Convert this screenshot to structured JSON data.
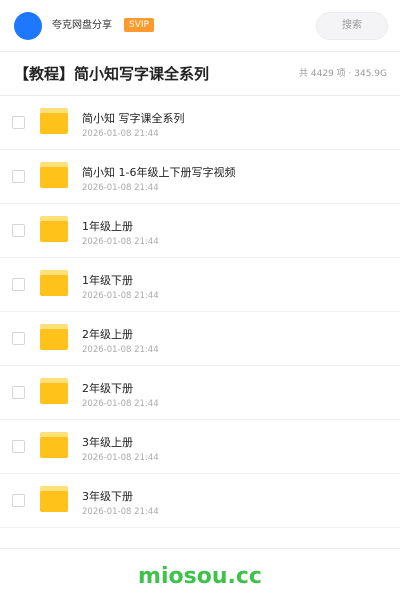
{
  "header": {
    "site_name": "夸克网盘分享",
    "badge": "SVIP",
    "search_label": "搜索",
    "colors": {
      "avatar": "#1e78ff",
      "badge": "#ff9a2e"
    }
  },
  "folder_title": "【教程】简小知写字课全系列",
  "stats": "共 4429 项 · 345.9G",
  "items": [
    {
      "name": "简小知 写字课全系列",
      "date": "2026-01-08 21:44",
      "icon": "folder-icon"
    },
    {
      "name": "简小知 1-6年级上下册写字视频",
      "date": "2026-01-08 21:44",
      "icon": "folder-icon"
    },
    {
      "name": "1年级上册",
      "date": "2026-01-08 21:44",
      "icon": "folder-icon"
    },
    {
      "name": "1年级下册",
      "date": "2026-01-08 21:44",
      "icon": "folder-icon"
    },
    {
      "name": "2年级上册",
      "date": "2026-01-08 21:44",
      "icon": "folder-icon"
    },
    {
      "name": "2年级下册",
      "date": "2026-01-08 21:44",
      "icon": "folder-icon"
    },
    {
      "name": "3年级上册",
      "date": "2026-01-08 21:44",
      "icon": "folder-icon"
    },
    {
      "name": "3年级下册",
      "date": "2026-01-08 21:44",
      "icon": "folder-icon"
    }
  ],
  "watermark": "miosou.cc",
  "colors": {
    "folder": "#ffc21a",
    "watermark": "#3ec24a"
  }
}
